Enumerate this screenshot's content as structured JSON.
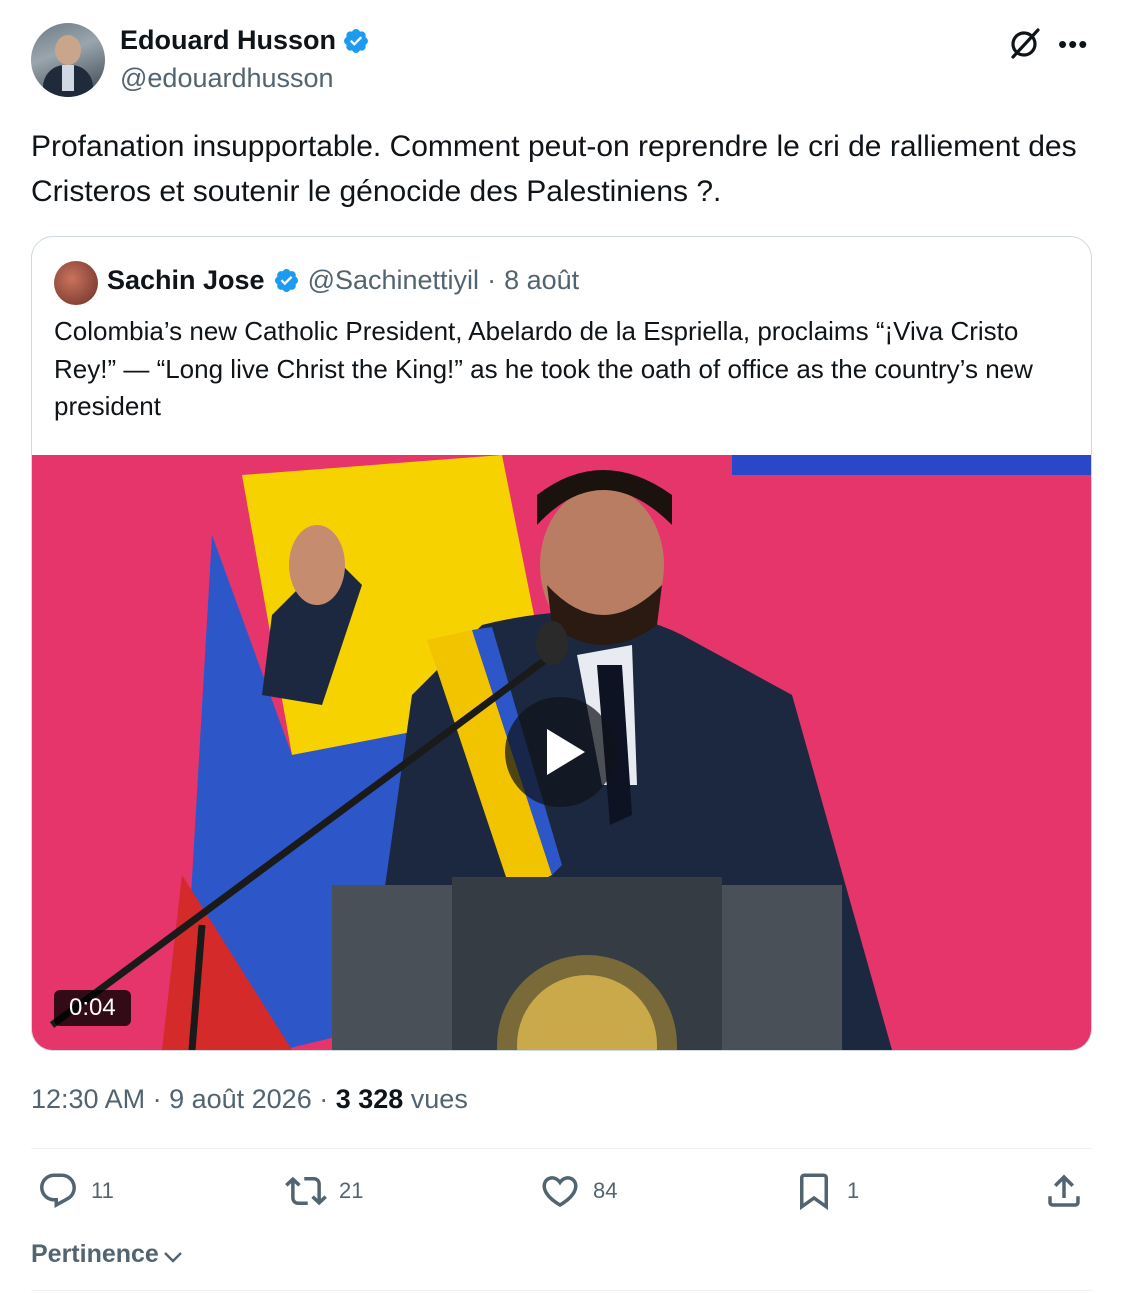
{
  "author": {
    "name": "Edouard Husson",
    "handle": "@edouardhusson",
    "verified": true
  },
  "post": {
    "text": "Profanation insupportable. Comment peut-on reprendre le cri de ralliement des Cristeros et soutenir le génocide des Palestiniens ?."
  },
  "quoted": {
    "name": "Sachin Jose",
    "handle": "@Sachinettiyil",
    "separator": "·",
    "date": "8 août",
    "text": "Colombia’s new Catholic President, Abelardo de la Espriella, proclaims “¡Viva Cristo Rey!” — “Long live Christ the King!” as he took the oath of office as the country’s new president",
    "video_duration": "0:04"
  },
  "meta": {
    "time_date": "12:30 AM · 9 août 2026 · ",
    "views_count": "3 328",
    "views_label": " vues"
  },
  "actions": {
    "replies": "11",
    "reposts": "21",
    "likes": "84",
    "bookmarks": "1"
  },
  "sort": {
    "label": "Pertinence"
  },
  "colors": {
    "verified": "#1d9bf0",
    "secondary_text": "#536471",
    "border": "#cfd9de"
  },
  "icons": [
    "grok-icon",
    "more-icon",
    "verified-badge-icon",
    "play-icon",
    "reply-icon",
    "repost-icon",
    "like-icon",
    "bookmark-icon",
    "share-icon",
    "chevron-down-icon"
  ]
}
